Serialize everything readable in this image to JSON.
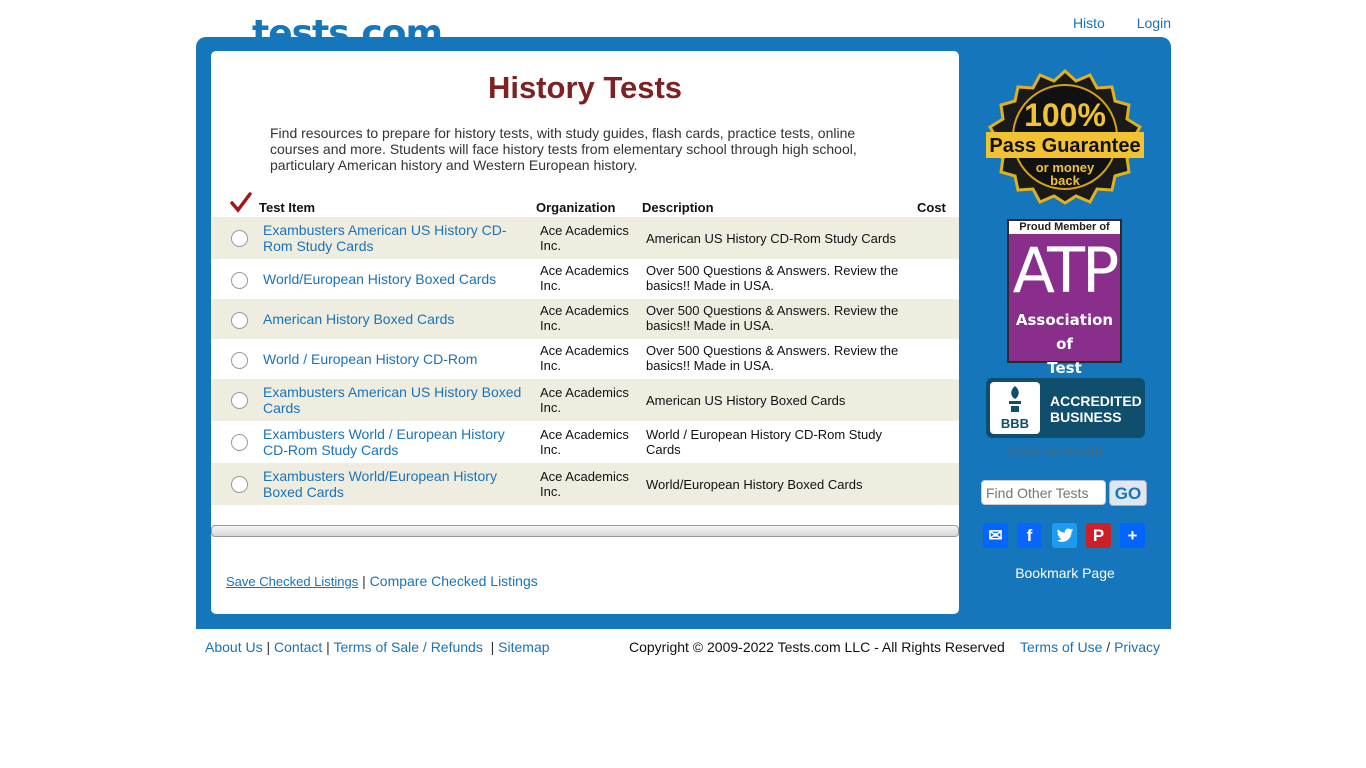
{
  "header": {
    "logo_text": "tests.com",
    "nav": [
      {
        "label": "Histo"
      },
      {
        "label": "Login"
      }
    ]
  },
  "main": {
    "title": "History Tests",
    "intro": "Find resources to prepare for history tests, with study guides, flash cards, practice tests, online courses and more. Students will face history tests from elementary school through high school, particulary American history and Western European history.",
    "columns": {
      "item": "Test Item",
      "org": "Organization",
      "desc": "Description",
      "cost": "Cost"
    },
    "rows": [
      {
        "item": "Exambusters American US History CD-Rom Study Cards",
        "org": "Ace Academics Inc.",
        "desc": "American US History CD-Rom Study Cards"
      },
      {
        "item": "World/European History Boxed Cards",
        "org": "Ace Academics Inc.",
        "desc": "Over 500 Questions & Answers. Review the basics!! Made in USA."
      },
      {
        "item": "American History Boxed Cards",
        "org": "Ace Academics Inc.",
        "desc": "Over 500 Questions & Answers. Review the basics!! Made in USA."
      },
      {
        "item": "World / European History CD-Rom",
        "org": "Ace Academics Inc.",
        "desc": "Over 500 Questions & Answers. Review the basics!! Made in USA."
      },
      {
        "item": "Exambusters American US History Boxed Cards",
        "org": "Ace Academics Inc.",
        "desc": "American US History Boxed Cards"
      },
      {
        "item": "Exambusters World / European History CD-Rom Study Cards",
        "org": "Ace Academics Inc.",
        "desc": "World / European History CD-Rom Study Cards"
      },
      {
        "item": "Exambusters World/European History Boxed Cards",
        "org": "Ace Academics Inc.",
        "desc": "World/European History Boxed Cards"
      }
    ],
    "actions": {
      "save": "Save Checked Listings",
      "separator": "|",
      "compare": "Compare Checked Listings"
    }
  },
  "sidebar": {
    "guarantee": {
      "line1": "100%",
      "line2": "Pass Guarantee",
      "line3": "or money",
      "line4": "back"
    },
    "atp": {
      "proud": "Proud Member of",
      "big": "ATP",
      "line1": "Association of",
      "line2": "Test Publishers"
    },
    "bbb": {
      "logo": "BBB",
      "line1": "ACCREDITED",
      "line2": "BUSINESS",
      "click": "Click for Profile"
    },
    "search": {
      "placeholder": "Find Other Tests",
      "go": "GO"
    },
    "social_icons": [
      "email-icon",
      "facebook-icon",
      "twitter-icon",
      "pinterest-icon",
      "share-plus-icon"
    ],
    "bookmark": "Bookmark Page"
  },
  "footer": {
    "links": [
      "About Us",
      "Contact",
      "Terms of Sale / Refunds",
      "Sitemap"
    ],
    "copyright": "Copyright © 2009-2022 Tests.com LLC - All Rights Reserved",
    "terms": "Terms of Use",
    "privacy": "Privacy"
  },
  "colors": {
    "brand_blue": "#1576bb",
    "title_red": "#7d2222",
    "row_alt": "#efede0",
    "link": "#1a73b8"
  }
}
